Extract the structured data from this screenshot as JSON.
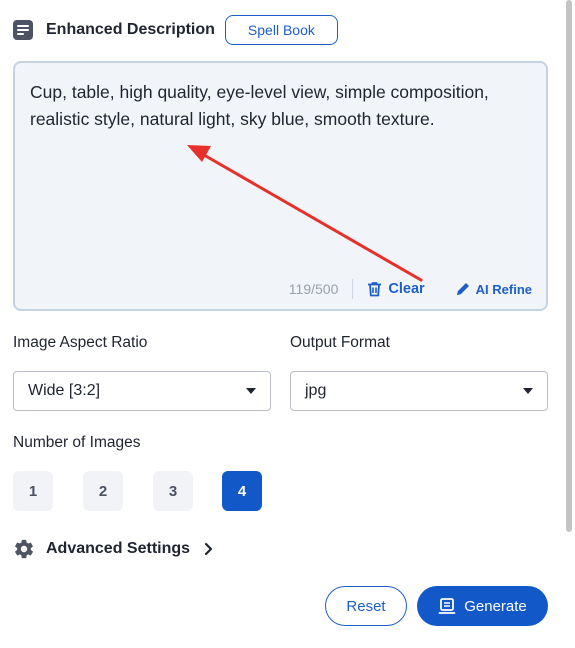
{
  "header": {
    "title": "Enhanced Description",
    "spell_book_label": "Spell Book",
    "icon": "document-lines-icon"
  },
  "description": {
    "text": "Cup, table, high quality, eye-level view, simple composition, realistic style, natural light, sky blue, smooth texture.",
    "counter": "119/500",
    "clear_label": "Clear",
    "refine_label": "AI Refine",
    "clear_icon": "trash-icon",
    "refine_icon": "pencil-icon"
  },
  "aspect_ratio": {
    "label": "Image Aspect Ratio",
    "selected": "Wide [3:2]"
  },
  "output_format": {
    "label": "Output Format",
    "selected": "jpg"
  },
  "num_images": {
    "label": "Number of Images",
    "options": [
      "1",
      "2",
      "3",
      "4"
    ],
    "selected": "4"
  },
  "advanced": {
    "label": "Advanced Settings",
    "icon": "gear-icon",
    "chevron": "chevron-right-icon"
  },
  "actions": {
    "reset_label": "Reset",
    "generate_label": "Generate",
    "generate_icon": "generate-icon"
  },
  "colors": {
    "accent": "#1358c9",
    "annotation_arrow": "#e8302a",
    "textarea_bg": "#f1f4f8"
  }
}
